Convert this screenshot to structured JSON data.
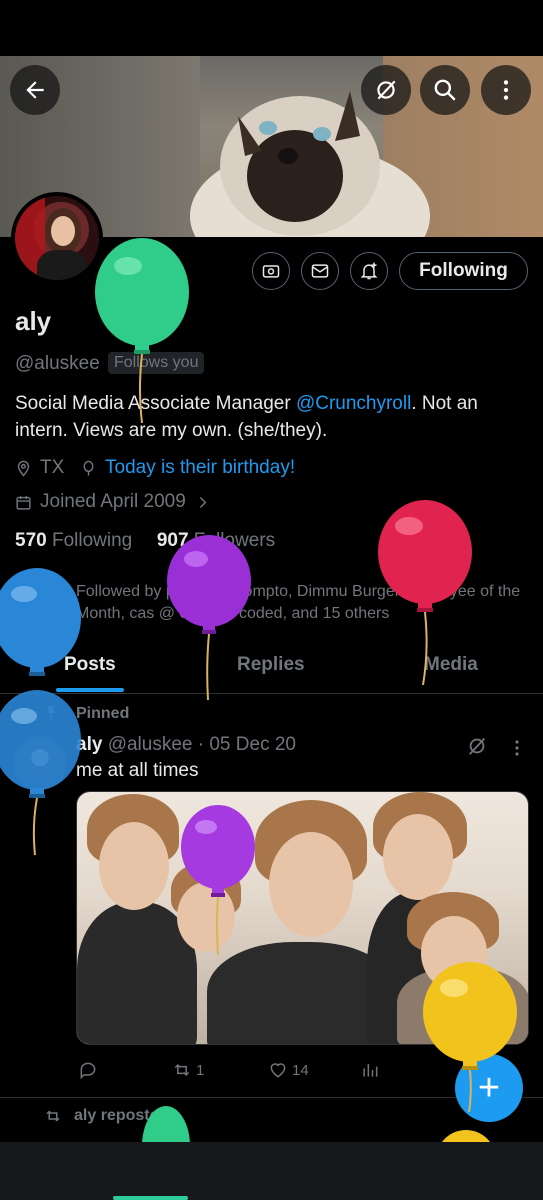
{
  "profile": {
    "name": "aly",
    "handle": "@aluskee",
    "follows_you": "Follows you",
    "bio_prefix": "Social Media Associate Manager ",
    "bio_mention": "@Crunchyroll",
    "bio_suffix": ". Not an intern. Views are my own. (she/they).",
    "location": "TX",
    "birthday": "Today is their birthday!",
    "joined": "Joined April 2009",
    "following_count": "570",
    "following_label": "Following",
    "followers_count": "907",
    "followers_label": "Followers",
    "followed_by": "Followed by prince👑prompto, Dimmu Burger Employee of the Month, cas @ old lady coded, and 15 others"
  },
  "header": {
    "follow_button": "Following",
    "icons": [
      "back-arrow-icon",
      "grok-icon",
      "search-icon",
      "more-vertical-icon"
    ]
  },
  "tabs": [
    {
      "label": "Posts",
      "active": true
    },
    {
      "label": "Replies",
      "active": false
    },
    {
      "label": "Media",
      "active": false
    }
  ],
  "pinned_post": {
    "pinned_label": "Pinned",
    "author": "aly",
    "handle_date": "@aluskee · 05 Dec 20",
    "text": "me at all times",
    "retweets": "1",
    "likes": "14"
  },
  "next_post": {
    "reposted_label": "aly reposted"
  },
  "fab_label": "+",
  "colors": {
    "accent": "#1d9bf0",
    "muted": "#71767b",
    "background": "#000000"
  }
}
